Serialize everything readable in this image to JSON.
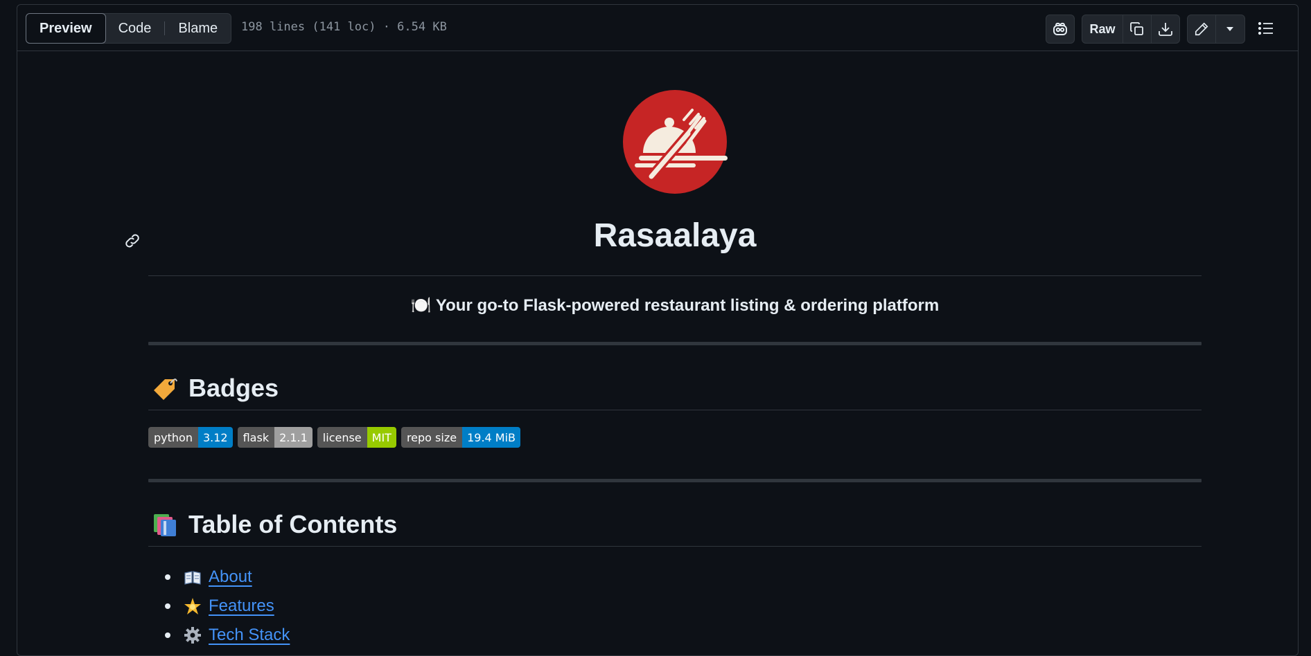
{
  "toolbar": {
    "tabs": [
      {
        "label": "Preview",
        "active": true
      },
      {
        "label": "Code",
        "active": false
      },
      {
        "label": "Blame",
        "active": false
      }
    ],
    "file_meta": "198 lines (141 loc) · 6.54 KB",
    "raw_label": "Raw",
    "icons": [
      "copilot-icon",
      "copy-icon",
      "download-icon",
      "pencil-icon",
      "triangle-down-icon",
      "list-unordered-icon"
    ]
  },
  "readme": {
    "logo_icon": "restaurant-cloche-fork-logo",
    "title": "Rasaalaya",
    "tagline_emoji": "🍽️",
    "tagline": "Your go-to Flask-powered restaurant listing & ordering platform",
    "badges_heading": {
      "emoji": "🏷️",
      "text": "Badges"
    },
    "badges": [
      {
        "label": "python",
        "value": "3.12",
        "color": "#007ec6"
      },
      {
        "label": "flask",
        "value": "2.1.1",
        "color": "#9f9f9f"
      },
      {
        "label": "license",
        "value": "MIT",
        "color": "#97ca00"
      },
      {
        "label": "repo size",
        "value": "19.4 MiB",
        "color": "#007ec6"
      }
    ],
    "toc_heading": {
      "emoji": "📚",
      "text": "Table of Contents"
    },
    "toc": [
      {
        "emoji": "📖",
        "label": "About"
      },
      {
        "emoji": "🌟",
        "label": "Features"
      },
      {
        "emoji": "⚙️",
        "label": "Tech Stack"
      }
    ]
  },
  "colors": {
    "background": "#0d1117",
    "border": "#30363d",
    "link": "#4493f8",
    "logo_red": "#c62525",
    "logo_cream": "#f5ecdf"
  }
}
